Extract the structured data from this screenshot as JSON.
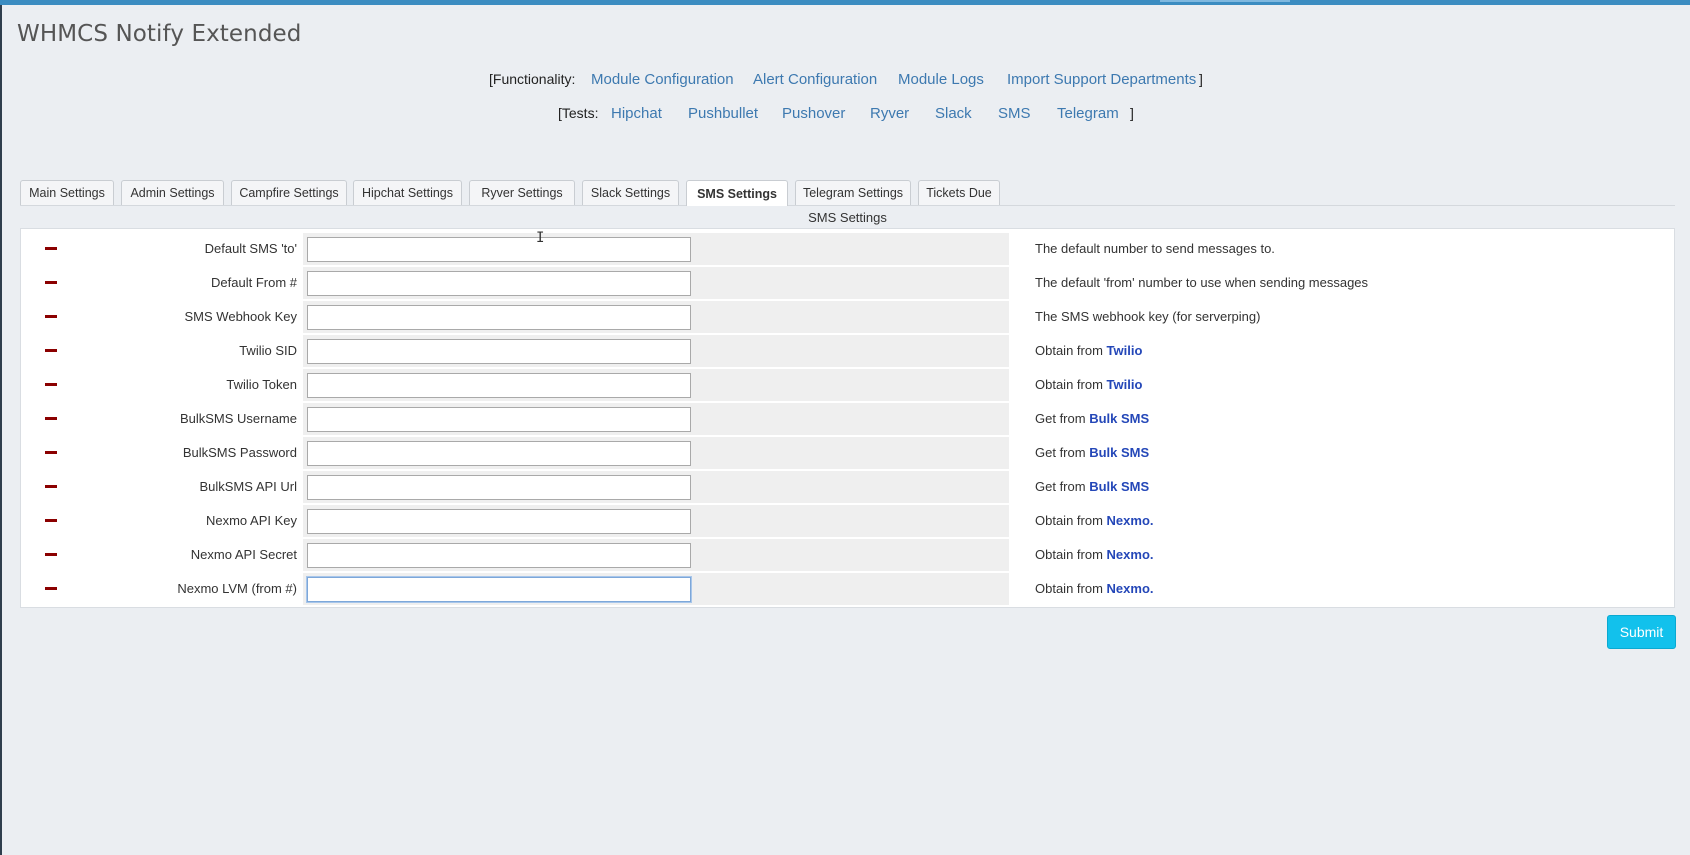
{
  "app": {
    "title": "WHMCS Notify Extended"
  },
  "functionality": {
    "open": "[Functionality:",
    "close": "]",
    "links": [
      "Module Configuration",
      "Alert Configuration",
      "Module Logs",
      "Import Support Departments"
    ]
  },
  "tests": {
    "open": "[Tests:",
    "close": "]",
    "links": [
      "Hipchat",
      "Pushbullet",
      "Pushover",
      "Ryver",
      "Slack",
      "SMS",
      "Telegram"
    ]
  },
  "tabs": [
    {
      "label": "Main Settings"
    },
    {
      "label": "Admin Settings"
    },
    {
      "label": "Campfire Settings"
    },
    {
      "label": "Hipchat Settings"
    },
    {
      "label": "Ryver Settings"
    },
    {
      "label": "Slack Settings"
    },
    {
      "label": "SMS Settings",
      "active": true
    },
    {
      "label": "Telegram Settings"
    },
    {
      "label": "Tickets Due"
    }
  ],
  "section": {
    "caption": "SMS Settings"
  },
  "fields": [
    {
      "label": "Default SMS 'to'",
      "value": "",
      "desc": "The default number to send messages to.",
      "link": ""
    },
    {
      "label": "Default From #",
      "value": "",
      "desc": "The default 'from' number to use when sending messages",
      "link": ""
    },
    {
      "label": "SMS Webhook Key",
      "value": "",
      "desc": "The SMS webhook key (for serverping)",
      "link": ""
    },
    {
      "label": "Twilio SID",
      "value": "",
      "desc": "Obtain from ",
      "link": "Twilio"
    },
    {
      "label": "Twilio Token",
      "value": "",
      "desc": "Obtain from ",
      "link": "Twilio"
    },
    {
      "label": "BulkSMS Username",
      "value": "",
      "desc": "Get from ",
      "link": "Bulk SMS"
    },
    {
      "label": "BulkSMS Password",
      "value": "",
      "desc": "Get from ",
      "link": "Bulk SMS"
    },
    {
      "label": "BulkSMS API Url",
      "value": "",
      "desc": "Get from ",
      "link": "Bulk SMS"
    },
    {
      "label": "Nexmo API Key",
      "value": "",
      "desc": "Obtain from ",
      "link": "Nexmo."
    },
    {
      "label": "Nexmo API Secret",
      "value": "",
      "desc": "Obtain from ",
      "link": "Nexmo."
    },
    {
      "label": "Nexmo LVM (from #)",
      "value": "",
      "desc": "Obtain from ",
      "link": "Nexmo."
    }
  ],
  "actions": {
    "submit_label": "Submit"
  },
  "colors": {
    "accent": "#3b8cc1",
    "link": "#3d79b0",
    "submit": "#12c1ec",
    "remove": "#8b0000"
  }
}
